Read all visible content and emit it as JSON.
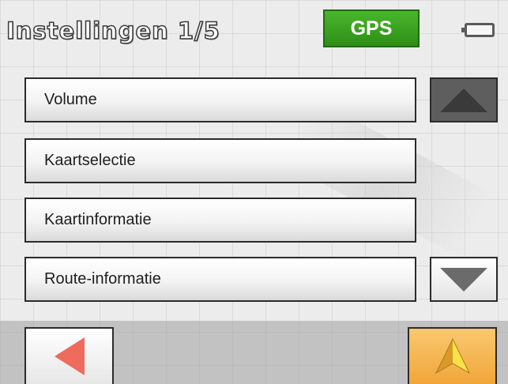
{
  "header": {
    "title": "Instellingen 1/5",
    "gps_label": "GPS",
    "gps_color": "#3aa520",
    "battery_icon": "battery-icon"
  },
  "menu": {
    "items": [
      {
        "label": "Volume"
      },
      {
        "label": "Kaartselectie"
      },
      {
        "label": "Kaartinformatie"
      },
      {
        "label": "Route-informatie"
      }
    ]
  },
  "scroll": {
    "up_icon": "triangle-up-icon",
    "down_icon": "triangle-down-icon"
  },
  "footer": {
    "back_icon": "arrow-left-icon",
    "back_color": "#ef6b5d",
    "navigate_icon": "navigation-arrow-icon",
    "navigate_color": "#f1a63a"
  }
}
